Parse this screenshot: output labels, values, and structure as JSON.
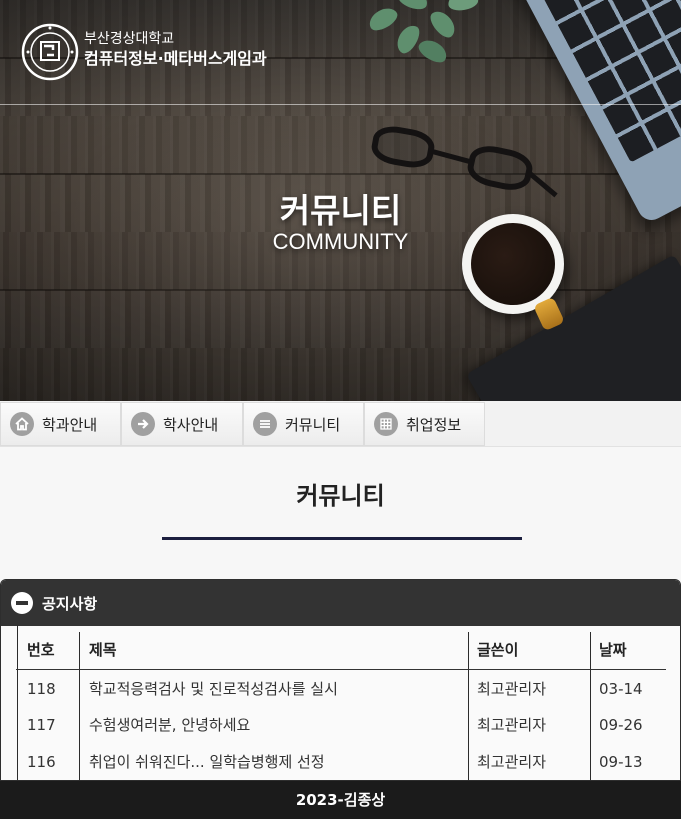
{
  "header": {
    "school_name": "부산경상대학교",
    "department": "컴퓨터정보·메타버스게임과"
  },
  "hero": {
    "title": "커뮤니티",
    "subtitle": "COMMUNITY"
  },
  "nav": {
    "items": [
      {
        "label": "학과안내",
        "icon": "home-icon"
      },
      {
        "label": "학사안내",
        "icon": "arrow-right-icon"
      },
      {
        "label": "커뮤니티",
        "icon": "menu-icon"
      },
      {
        "label": "취업정보",
        "icon": "grid-icon"
      }
    ]
  },
  "main": {
    "page_title": "커뮤니티"
  },
  "notice": {
    "title": "공지사항",
    "columns": [
      "번호",
      "제목",
      "글쓴이",
      "날짜"
    ],
    "rows": [
      {
        "no": "118",
        "subject": "학교적응력검사 및 진로적성검사를 실시",
        "author": "최고관리자",
        "date": "03-14"
      },
      {
        "no": "117",
        "subject": "수험생여러분, 안녕하세요",
        "author": "최고관리자",
        "date": "09-26"
      },
      {
        "no": "116",
        "subject": "취업이 쉬워진다... 일학습병행제 선정",
        "author": "최고관리자",
        "date": "09-13"
      }
    ]
  },
  "footer": {
    "text": "2023-김종상"
  },
  "colors": {
    "title_rule": "#1c1f3f",
    "panel_header": "#333333",
    "footer": "#1b1b1b"
  }
}
